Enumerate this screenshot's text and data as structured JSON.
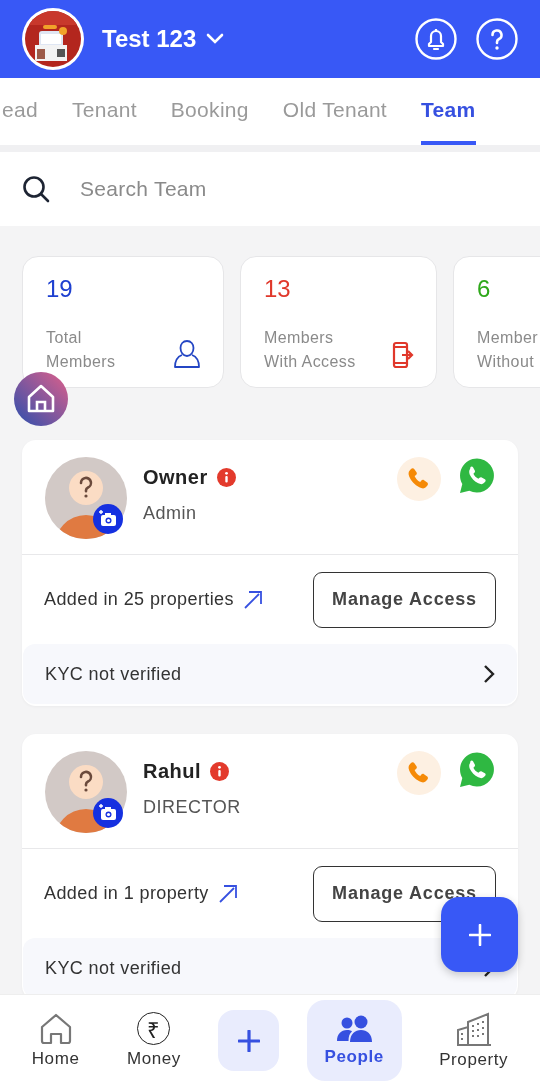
{
  "header": {
    "title": "Test 123"
  },
  "tabs": [
    {
      "label": "ead",
      "selected": false
    },
    {
      "label": "Tenant",
      "selected": false
    },
    {
      "label": "Booking",
      "selected": false
    },
    {
      "label": "Old Tenant",
      "selected": false
    },
    {
      "label": "Team",
      "selected": true
    }
  ],
  "search": {
    "placeholder": "Search Team"
  },
  "stats": [
    {
      "kind": "total",
      "value": "19",
      "color": "#1e40d0",
      "lines": [
        "Total",
        "Members"
      ]
    },
    {
      "kind": "with-access",
      "value": "13",
      "color": "#e0382b",
      "lines": [
        "Members",
        "With Access"
      ]
    },
    {
      "kind": "without-access",
      "value": "6",
      "color": "#2ea81a",
      "lines": [
        "Member",
        "Without"
      ]
    }
  ],
  "members": [
    {
      "name": "Owner",
      "role": "Admin",
      "properties": "Added in 25 properties",
      "action": "Manage Access",
      "kyc": "KYC not verified"
    },
    {
      "name": "Rahul",
      "role": "DIRECTOR",
      "properties": "Added in 1 property",
      "action": "Manage Access",
      "kyc": "KYC not verified"
    }
  ],
  "nav": [
    {
      "kind": "home",
      "label": "Home",
      "selected": false
    },
    {
      "kind": "money",
      "label": "Money",
      "glyph": "₹",
      "selected": false
    },
    {
      "kind": "add",
      "selected": false
    },
    {
      "kind": "people",
      "label": "People",
      "selected": true
    },
    {
      "kind": "property",
      "label": "Property",
      "selected": false
    }
  ]
}
